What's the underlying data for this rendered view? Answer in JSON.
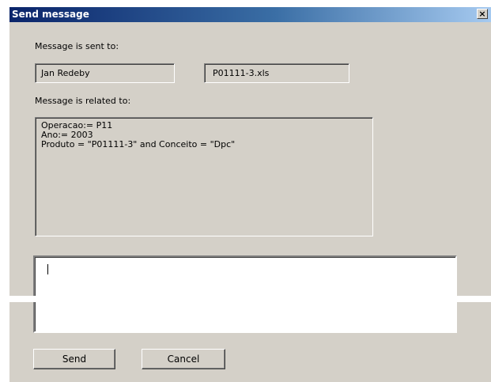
{
  "window": {
    "title": "Send message",
    "close_glyph": "×"
  },
  "recipients": {
    "label": "Message is sent to:",
    "person": "Jan Redeby",
    "file": "P01111-3.xls"
  },
  "related": {
    "label": "Message is related  to:",
    "lines": [
      "Operacao:= P11",
      "Ano:= 2003",
      "Produto = \"P01111-3\" and Conceito = \"Dpc\""
    ]
  },
  "message": {
    "value": ""
  },
  "buttons": {
    "send": "Send",
    "cancel": "Cancel"
  }
}
